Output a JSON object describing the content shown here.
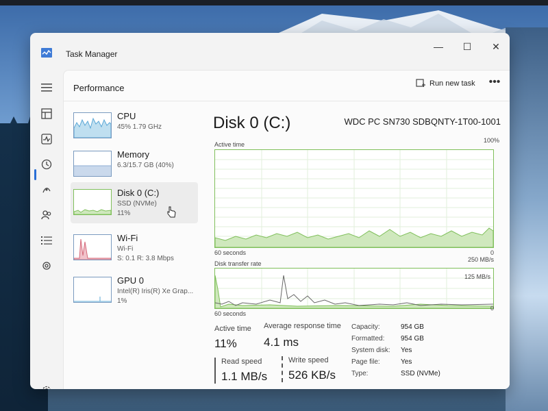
{
  "window": {
    "title": "Task Manager",
    "controls": {
      "minimize": "—",
      "maximize": "☐",
      "close": "✕"
    }
  },
  "nav": {
    "items": [
      "menu-icon",
      "processes-icon",
      "performance-icon",
      "app-history-icon",
      "startup-apps-icon",
      "users-icon",
      "details-icon",
      "services-icon"
    ],
    "active": "performance-icon",
    "settings": "settings-icon"
  },
  "header": {
    "title": "Performance",
    "run_new_task": "Run new task",
    "more": "•••"
  },
  "sidebar": {
    "items": [
      {
        "name": "CPU",
        "line1": "45%  1.79 GHz",
        "line2": ""
      },
      {
        "name": "Memory",
        "line1": "6.3/15.7 GB (40%)",
        "line2": ""
      },
      {
        "name": "Disk 0 (C:)",
        "line1": "SSD (NVMe)",
        "line2": "11%"
      },
      {
        "name": "Wi-Fi",
        "line1": "Wi-Fi",
        "line2": "S: 0.1  R: 3.8 Mbps"
      },
      {
        "name": "GPU 0",
        "line1": "Intel(R) Iris(R) Xe Grap...",
        "line2": "1%"
      }
    ],
    "selected_index": 2
  },
  "detail": {
    "title": "Disk 0 (C:)",
    "model": "WDC PC SN730 SDBQNTY-1T00-1001",
    "graph1": {
      "label": "Active time",
      "max": "100%",
      "xlabel": "60 seconds",
      "min": "0"
    },
    "graph2": {
      "label": "Disk transfer rate",
      "max": "250 MB/s",
      "mid": "125 MB/s",
      "xlabel": "60 seconds",
      "min": "0"
    },
    "stats": {
      "active_time_label": "Active time",
      "active_time": "11%",
      "avg_response_label": "Average response time",
      "avg_response": "4.1 ms",
      "read_speed_label": "Read speed",
      "read_speed": "1.1 MB/s",
      "write_speed_label": "Write speed",
      "write_speed": "526 KB/s"
    },
    "info": [
      {
        "label": "Capacity:",
        "value": "954 GB"
      },
      {
        "label": "Formatted:",
        "value": "954 GB"
      },
      {
        "label": "System disk:",
        "value": "Yes"
      },
      {
        "label": "Page file:",
        "value": "Yes"
      },
      {
        "label": "Type:",
        "value": "SSD (NVMe)"
      }
    ]
  },
  "colors": {
    "accent": "#2a6fd6",
    "disk_green": "#7fbf5a",
    "cpu_blue": "#5aa7d6",
    "memory_blue": "#8faed3",
    "wifi_pink": "#d4687a"
  }
}
